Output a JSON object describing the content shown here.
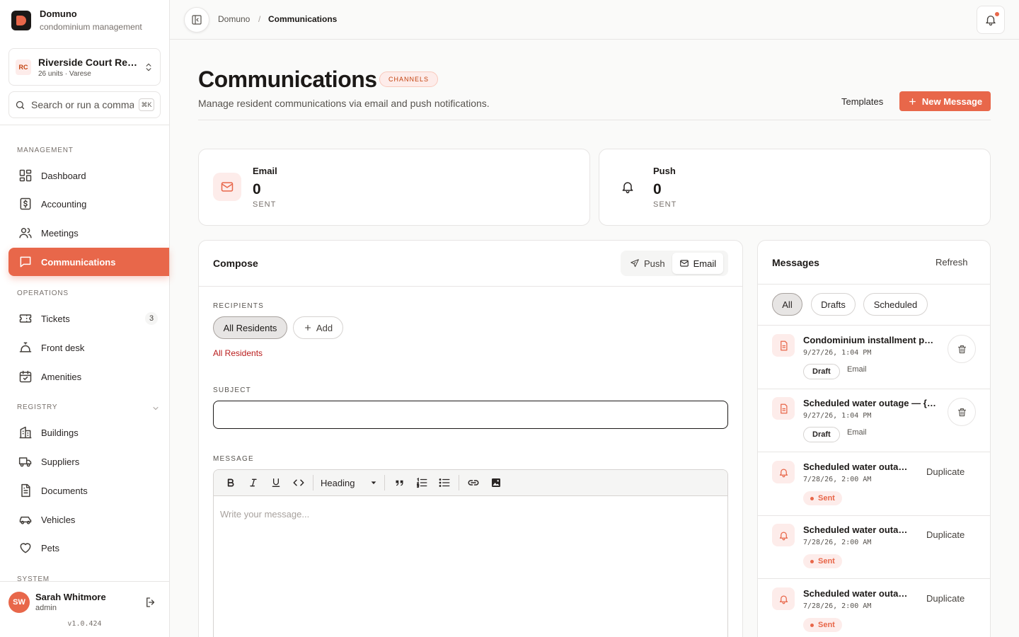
{
  "app": {
    "name": "Domuno",
    "tagline": "condominium management"
  },
  "org": {
    "badge": "RC",
    "name": "Riverside Court Residences",
    "meta": "26 units · Varese"
  },
  "search": {
    "placeholder": "Search or run a command",
    "shortcut": "⌘K"
  },
  "sidebar": {
    "sections": {
      "management": "MANAGEMENT",
      "operations": "OPERATIONS",
      "registry": "REGISTRY",
      "system": "SYSTEM"
    },
    "items": [
      {
        "label": "Dashboard",
        "icon": "dashboard-icon"
      },
      {
        "label": "Accounting",
        "icon": "dollar-icon"
      },
      {
        "label": "Meetings",
        "icon": "users-icon"
      },
      {
        "label": "Communications",
        "icon": "message-icon",
        "active": true
      },
      {
        "label": "Tickets",
        "icon": "ticket-icon",
        "badge": "3"
      },
      {
        "label": "Front desk",
        "icon": "bell-service-icon"
      },
      {
        "label": "Amenities",
        "icon": "calendar-icon"
      },
      {
        "label": "Buildings",
        "icon": "building-icon"
      },
      {
        "label": "Suppliers",
        "icon": "truck-icon"
      },
      {
        "label": "Documents",
        "icon": "file-icon"
      },
      {
        "label": "Vehicles",
        "icon": "car-icon"
      },
      {
        "label": "Pets",
        "icon": "heart-icon"
      }
    ]
  },
  "user": {
    "initials": "SW",
    "name": "Sarah Whitmore",
    "role": "admin",
    "version": "v1.0.424"
  },
  "breadcrumb": {
    "root": "Domuno",
    "separator": "/",
    "current": "Communications"
  },
  "page": {
    "title": "Communications",
    "pill": "CHANNELS",
    "subtitle": "Manage resident communications via email and push notifications.",
    "templates_label": "Templates",
    "new_message_label": "New Message"
  },
  "stats": [
    {
      "label": "Email",
      "value": "0",
      "unit": "SENT",
      "icon": "mail-icon"
    },
    {
      "label": "Push",
      "value": "0",
      "unit": "SENT",
      "icon": "bell-icon"
    }
  ],
  "compose": {
    "title": "Compose",
    "channels": [
      "Push",
      "Email"
    ],
    "selected_channel": "Email",
    "recipients_label": "RECIPIENTS",
    "recipient_chip": "All Residents",
    "add_label": "Add",
    "recipients_summary": "All Residents",
    "subject_label": "SUBJECT",
    "subject_value": "",
    "message_label": "MESSAGE",
    "heading_select": "Heading",
    "message_placeholder": "Write your message..."
  },
  "messages": {
    "title": "Messages",
    "refresh_label": "Refresh",
    "filters": [
      "All",
      "Drafts",
      "Scheduled"
    ],
    "active_filter": "All",
    "items": [
      {
        "title": "Condominium installment payment reminder",
        "date": "9/27/26, 1:04 PM",
        "status": "Draft",
        "channel": "Email",
        "action": "delete"
      },
      {
        "title": "Scheduled water outage — {{title}}",
        "date": "9/27/26, 1:04 PM",
        "status": "Draft",
        "channel": "Email",
        "action": "delete"
      },
      {
        "title": "Scheduled water outage notice",
        "date": "7/28/26, 2:00 AM",
        "status": "Sent",
        "action_label": "Duplicate"
      },
      {
        "title": "Scheduled water outage notice",
        "date": "7/28/26, 2:00 AM",
        "status": "Sent",
        "action_label": "Duplicate"
      },
      {
        "title": "Scheduled water outage notice",
        "date": "7/28/26, 2:00 AM",
        "status": "Sent",
        "action_label": "Duplicate"
      }
    ]
  },
  "colors": {
    "accent": "#e8674a",
    "text": "#1c1917",
    "muted": "#57534e",
    "border": "#e7e5e4",
    "background": "#fafaf9"
  }
}
